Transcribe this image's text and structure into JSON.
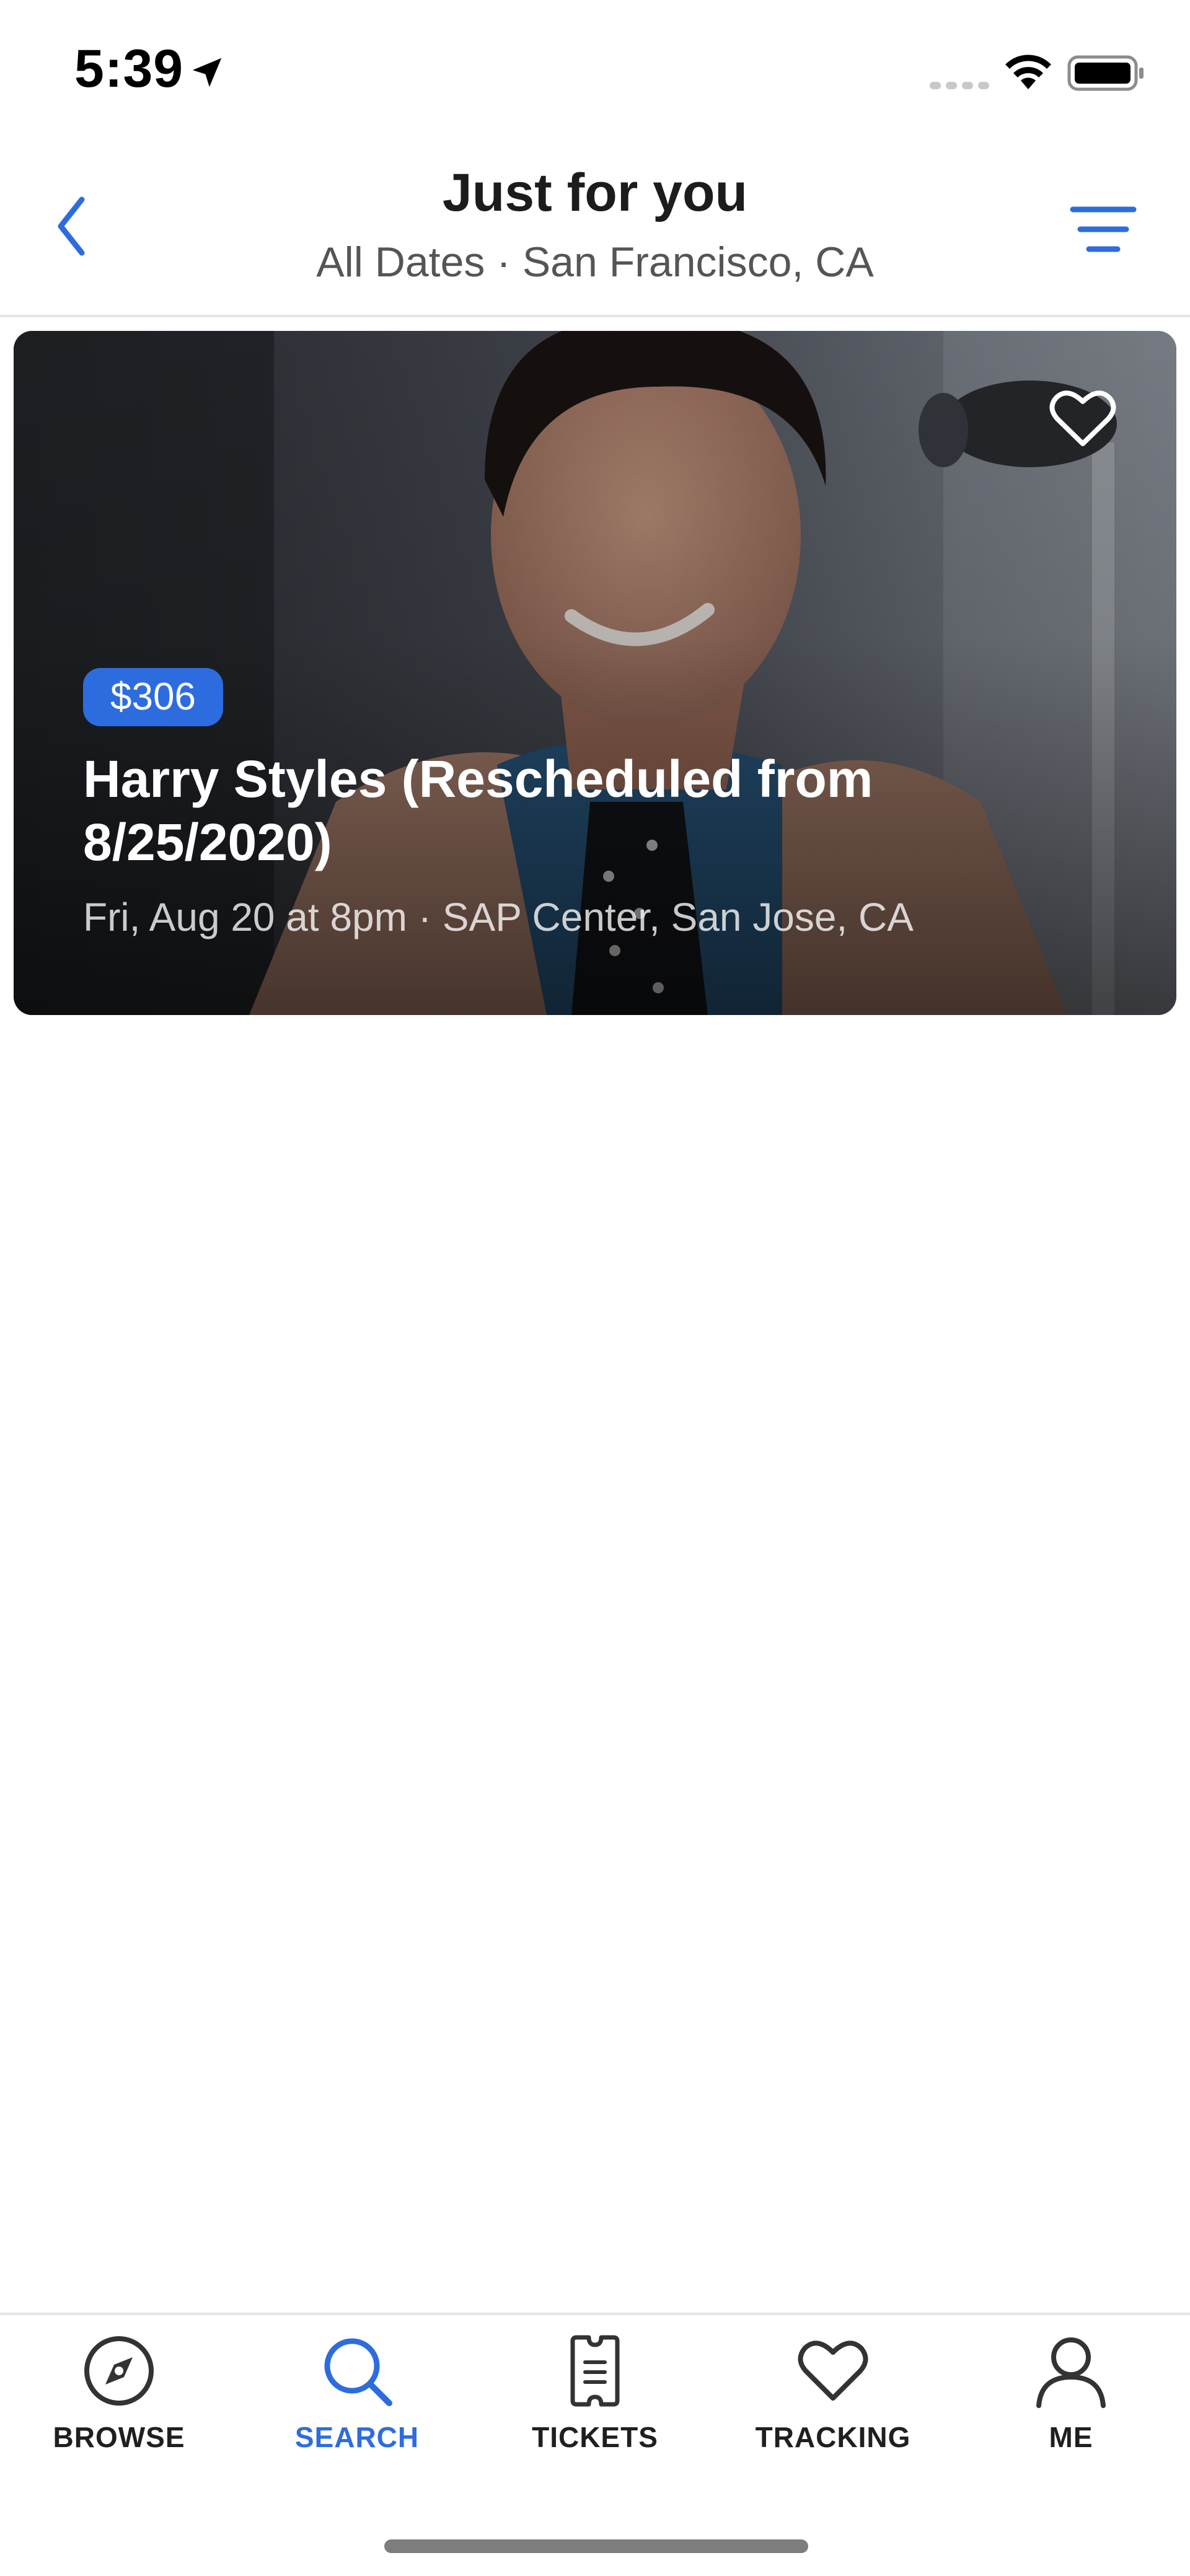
{
  "status_bar": {
    "time": "5:39"
  },
  "header": {
    "title": "Just for you",
    "subtitle": "All Dates · San Francisco, CA"
  },
  "events": [
    {
      "price": "$306",
      "title": "Harry Styles (Rescheduled from 8/25/2020)",
      "meta": "Fri, Aug 20 at 8pm · SAP Center, San Jose, CA",
      "favorited": false
    }
  ],
  "tab_bar": {
    "tabs": [
      {
        "label": "BROWSE",
        "icon": "compass-icon",
        "active": false
      },
      {
        "label": "SEARCH",
        "icon": "search-icon",
        "active": true
      },
      {
        "label": "TICKETS",
        "icon": "ticket-icon",
        "active": false
      },
      {
        "label": "TRACKING",
        "icon": "heart-icon",
        "active": false
      },
      {
        "label": "ME",
        "icon": "person-icon",
        "active": false
      }
    ]
  },
  "colors": {
    "accent": "#2d6cdf",
    "text_primary": "#1f1f1f",
    "text_secondary": "#555555",
    "divider": "#e4e4e4"
  }
}
